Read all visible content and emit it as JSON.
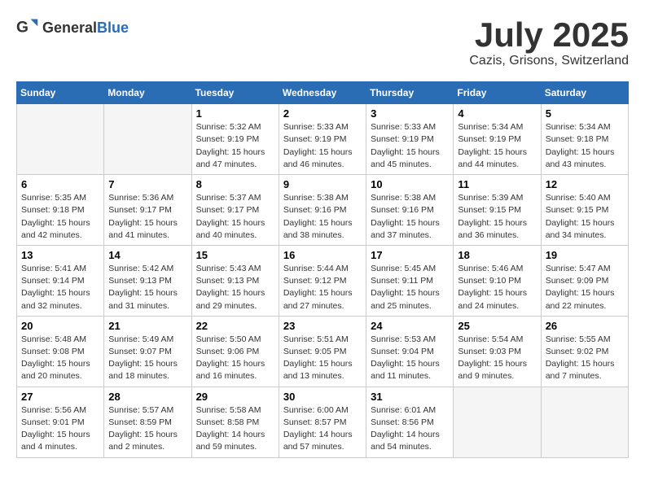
{
  "header": {
    "logo_general": "General",
    "logo_blue": "Blue",
    "month": "July 2025",
    "location": "Cazis, Grisons, Switzerland"
  },
  "days_of_week": [
    "Sunday",
    "Monday",
    "Tuesday",
    "Wednesday",
    "Thursday",
    "Friday",
    "Saturday"
  ],
  "weeks": [
    [
      {
        "day": "",
        "detail": ""
      },
      {
        "day": "",
        "detail": ""
      },
      {
        "day": "1",
        "detail": "Sunrise: 5:32 AM\nSunset: 9:19 PM\nDaylight: 15 hours\nand 47 minutes."
      },
      {
        "day": "2",
        "detail": "Sunrise: 5:33 AM\nSunset: 9:19 PM\nDaylight: 15 hours\nand 46 minutes."
      },
      {
        "day": "3",
        "detail": "Sunrise: 5:33 AM\nSunset: 9:19 PM\nDaylight: 15 hours\nand 45 minutes."
      },
      {
        "day": "4",
        "detail": "Sunrise: 5:34 AM\nSunset: 9:19 PM\nDaylight: 15 hours\nand 44 minutes."
      },
      {
        "day": "5",
        "detail": "Sunrise: 5:34 AM\nSunset: 9:18 PM\nDaylight: 15 hours\nand 43 minutes."
      }
    ],
    [
      {
        "day": "6",
        "detail": "Sunrise: 5:35 AM\nSunset: 9:18 PM\nDaylight: 15 hours\nand 42 minutes."
      },
      {
        "day": "7",
        "detail": "Sunrise: 5:36 AM\nSunset: 9:17 PM\nDaylight: 15 hours\nand 41 minutes."
      },
      {
        "day": "8",
        "detail": "Sunrise: 5:37 AM\nSunset: 9:17 PM\nDaylight: 15 hours\nand 40 minutes."
      },
      {
        "day": "9",
        "detail": "Sunrise: 5:38 AM\nSunset: 9:16 PM\nDaylight: 15 hours\nand 38 minutes."
      },
      {
        "day": "10",
        "detail": "Sunrise: 5:38 AM\nSunset: 9:16 PM\nDaylight: 15 hours\nand 37 minutes."
      },
      {
        "day": "11",
        "detail": "Sunrise: 5:39 AM\nSunset: 9:15 PM\nDaylight: 15 hours\nand 36 minutes."
      },
      {
        "day": "12",
        "detail": "Sunrise: 5:40 AM\nSunset: 9:15 PM\nDaylight: 15 hours\nand 34 minutes."
      }
    ],
    [
      {
        "day": "13",
        "detail": "Sunrise: 5:41 AM\nSunset: 9:14 PM\nDaylight: 15 hours\nand 32 minutes."
      },
      {
        "day": "14",
        "detail": "Sunrise: 5:42 AM\nSunset: 9:13 PM\nDaylight: 15 hours\nand 31 minutes."
      },
      {
        "day": "15",
        "detail": "Sunrise: 5:43 AM\nSunset: 9:13 PM\nDaylight: 15 hours\nand 29 minutes."
      },
      {
        "day": "16",
        "detail": "Sunrise: 5:44 AM\nSunset: 9:12 PM\nDaylight: 15 hours\nand 27 minutes."
      },
      {
        "day": "17",
        "detail": "Sunrise: 5:45 AM\nSunset: 9:11 PM\nDaylight: 15 hours\nand 25 minutes."
      },
      {
        "day": "18",
        "detail": "Sunrise: 5:46 AM\nSunset: 9:10 PM\nDaylight: 15 hours\nand 24 minutes."
      },
      {
        "day": "19",
        "detail": "Sunrise: 5:47 AM\nSunset: 9:09 PM\nDaylight: 15 hours\nand 22 minutes."
      }
    ],
    [
      {
        "day": "20",
        "detail": "Sunrise: 5:48 AM\nSunset: 9:08 PM\nDaylight: 15 hours\nand 20 minutes."
      },
      {
        "day": "21",
        "detail": "Sunrise: 5:49 AM\nSunset: 9:07 PM\nDaylight: 15 hours\nand 18 minutes."
      },
      {
        "day": "22",
        "detail": "Sunrise: 5:50 AM\nSunset: 9:06 PM\nDaylight: 15 hours\nand 16 minutes."
      },
      {
        "day": "23",
        "detail": "Sunrise: 5:51 AM\nSunset: 9:05 PM\nDaylight: 15 hours\nand 13 minutes."
      },
      {
        "day": "24",
        "detail": "Sunrise: 5:53 AM\nSunset: 9:04 PM\nDaylight: 15 hours\nand 11 minutes."
      },
      {
        "day": "25",
        "detail": "Sunrise: 5:54 AM\nSunset: 9:03 PM\nDaylight: 15 hours\nand 9 minutes."
      },
      {
        "day": "26",
        "detail": "Sunrise: 5:55 AM\nSunset: 9:02 PM\nDaylight: 15 hours\nand 7 minutes."
      }
    ],
    [
      {
        "day": "27",
        "detail": "Sunrise: 5:56 AM\nSunset: 9:01 PM\nDaylight: 15 hours\nand 4 minutes."
      },
      {
        "day": "28",
        "detail": "Sunrise: 5:57 AM\nSunset: 8:59 PM\nDaylight: 15 hours\nand 2 minutes."
      },
      {
        "day": "29",
        "detail": "Sunrise: 5:58 AM\nSunset: 8:58 PM\nDaylight: 14 hours\nand 59 minutes."
      },
      {
        "day": "30",
        "detail": "Sunrise: 6:00 AM\nSunset: 8:57 PM\nDaylight: 14 hours\nand 57 minutes."
      },
      {
        "day": "31",
        "detail": "Sunrise: 6:01 AM\nSunset: 8:56 PM\nDaylight: 14 hours\nand 54 minutes."
      },
      {
        "day": "",
        "detail": ""
      },
      {
        "day": "",
        "detail": ""
      }
    ]
  ]
}
